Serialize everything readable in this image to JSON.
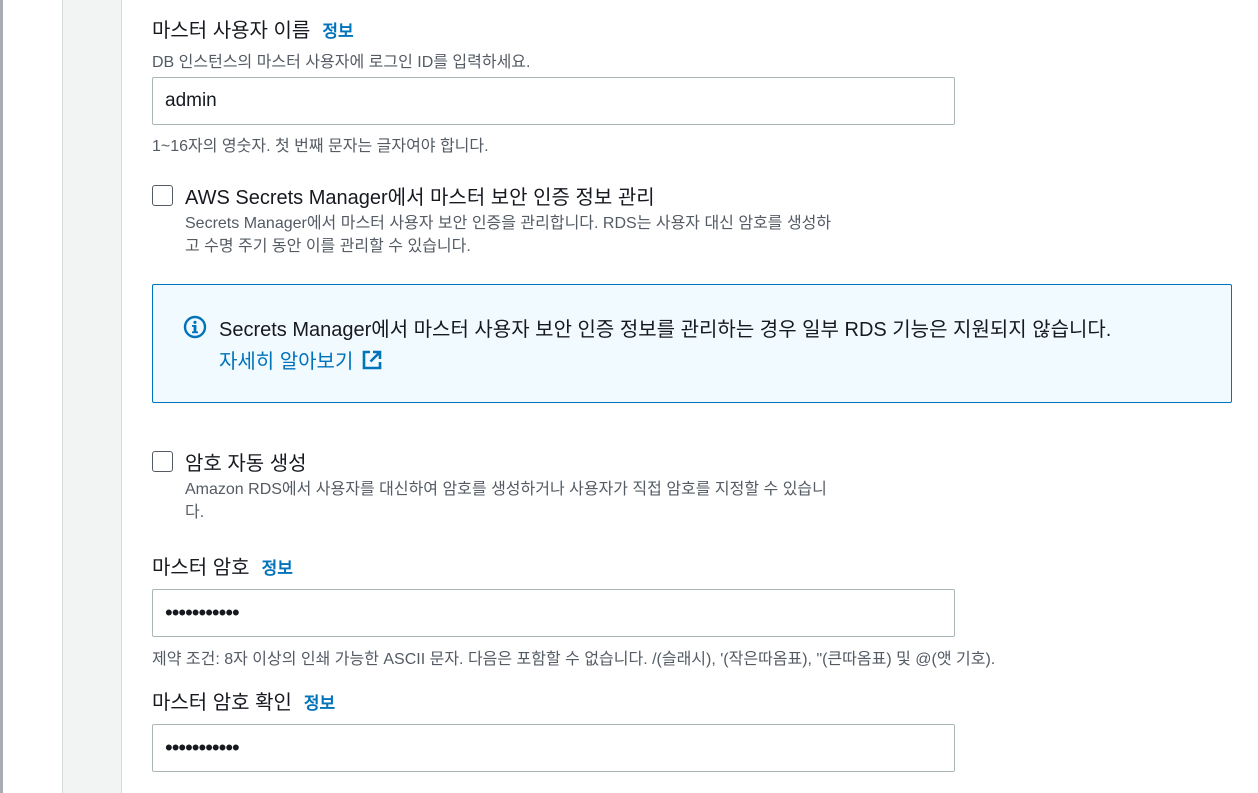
{
  "username": {
    "label": "마스터 사용자 이름",
    "info": "정보",
    "description": "DB 인스턴스의 마스터 사용자에 로그인 ID를 입력하세요.",
    "value": "admin",
    "constraint": "1~16자의 영숫자. 첫 번째 문자는 글자여야 합니다."
  },
  "secrets_manager": {
    "checked": false,
    "label": "AWS Secrets Manager에서 마스터 보안 인증 정보 관리",
    "description_line1": "Secrets Manager에서 마스터 사용자 보안 인증을 관리합니다. RDS는 사용자 대신 암호를 생성하",
    "description_line2": "고 수명 주기 동안 이를 관리할 수 있습니다."
  },
  "info_alert": {
    "icon": "info-circle-icon",
    "message": "Secrets Manager에서 마스터 사용자 보안 인증 정보를 관리하는 경우 일부 RDS 기능은 지원되지 않습니다.",
    "link_text": "자세히 알아보기",
    "link_icon": "external-link-icon"
  },
  "auto_generate": {
    "checked": false,
    "label": "암호 자동 생성",
    "description_line1": "Amazon RDS에서 사용자를 대신하여 암호를 생성하거나 사용자가 직접 암호를 지정할 수 있습니",
    "description_line2": "다."
  },
  "master_password": {
    "label": "마스터 암호",
    "info": "정보",
    "masked_value": "•••••••••••",
    "constraint": "제약 조건: 8자 이상의 인쇄 가능한 ASCII 문자. 다음은 포함할 수 없습니다. /(슬래시), '(작은따옴표), \"(큰따옴표) 및 @(앳 기호)."
  },
  "confirm_password": {
    "label": "마스터 암호 확인",
    "info": "정보",
    "masked_value": "•••••••••••"
  },
  "colors": {
    "link": "#0073bb",
    "text": "#16191f",
    "secondary_text": "#545b64",
    "info_bg": "#f1faff",
    "input_border": "#aab7b8"
  }
}
